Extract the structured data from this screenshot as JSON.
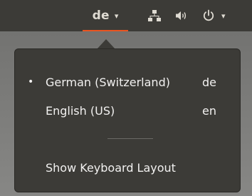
{
  "top_panel": {
    "input_source": {
      "label": "de",
      "arrow": "▾"
    },
    "power_menu": {
      "arrow": "▾"
    },
    "icons": {
      "network": "network-icon",
      "sound": "volume-icon",
      "power": "power-icon"
    }
  },
  "keyboard_menu": {
    "items": [
      {
        "bullet": "•",
        "name": "German (Switzerland)",
        "code": "de",
        "selected": true
      },
      {
        "bullet": "",
        "name": "English (US)",
        "code": "en",
        "selected": false
      }
    ],
    "show_layout_label": "Show Keyboard Layout"
  },
  "colors": {
    "panel": "#3c3b37",
    "text": "#f2f1f0",
    "accent": "#e95420"
  }
}
